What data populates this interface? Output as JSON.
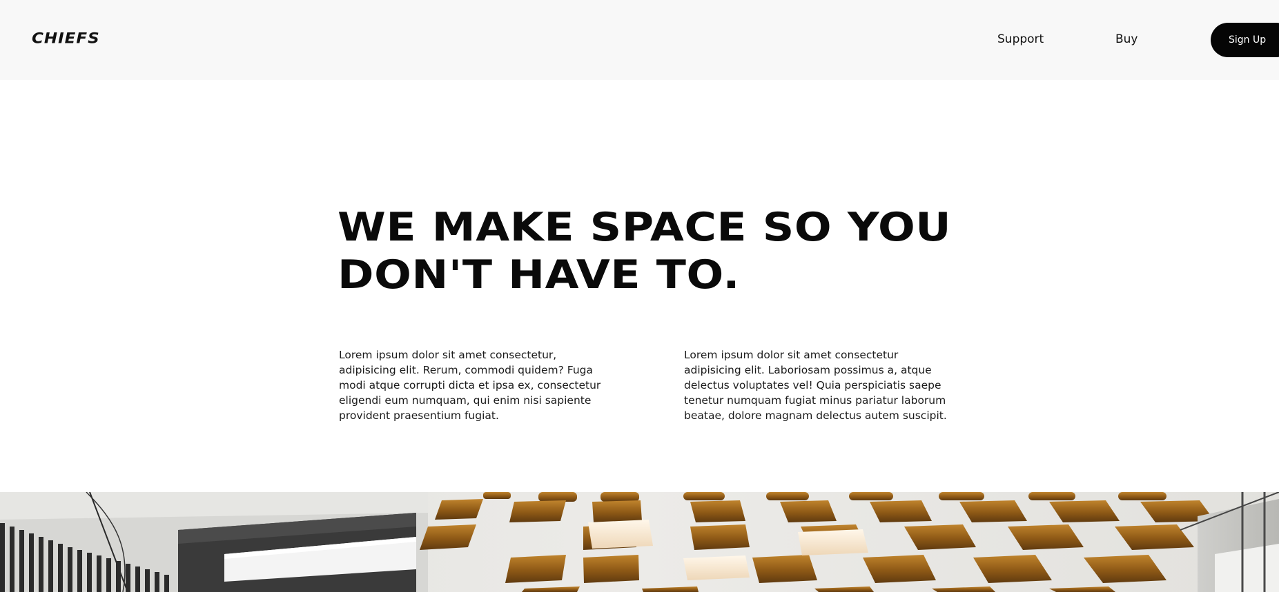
{
  "header": {
    "logo_text": "CHIEFS",
    "nav": {
      "support_label": "Support",
      "buy_label": "Buy"
    },
    "signup_label": "Sign Up"
  },
  "hero": {
    "title_line1": "WE MAKE SPACE SO YOU",
    "title_line2": "DON'T HAVE TO.",
    "paragraph_left": "Lorem ipsum dolor sit amet consectetur, adipisicing elit. Rerum, commodi quidem? Fuga modi atque corrupti dicta et ipsa ex, consectetur eligendi eum numquam, qui enim nisi sapiente provident praesentium fugiat.",
    "paragraph_right": "Lorem ipsum dolor sit amet consectetur adipisicing elit. Laboriosam possimus a, atque delectus voluptates vel! Quia perspiciatis saepe tenetur numquam fugiat minus pariatur laborum beatae, dolore magnam delectus autem suscipit."
  },
  "colors": {
    "header_bg": "#f8f8f8",
    "page_bg": "#ffffff",
    "text": "#111111",
    "button_bg": "#050505",
    "button_text": "#ffffff",
    "ceiling_wood": "#a56a1c",
    "ceiling_white": "#ecebe8"
  }
}
